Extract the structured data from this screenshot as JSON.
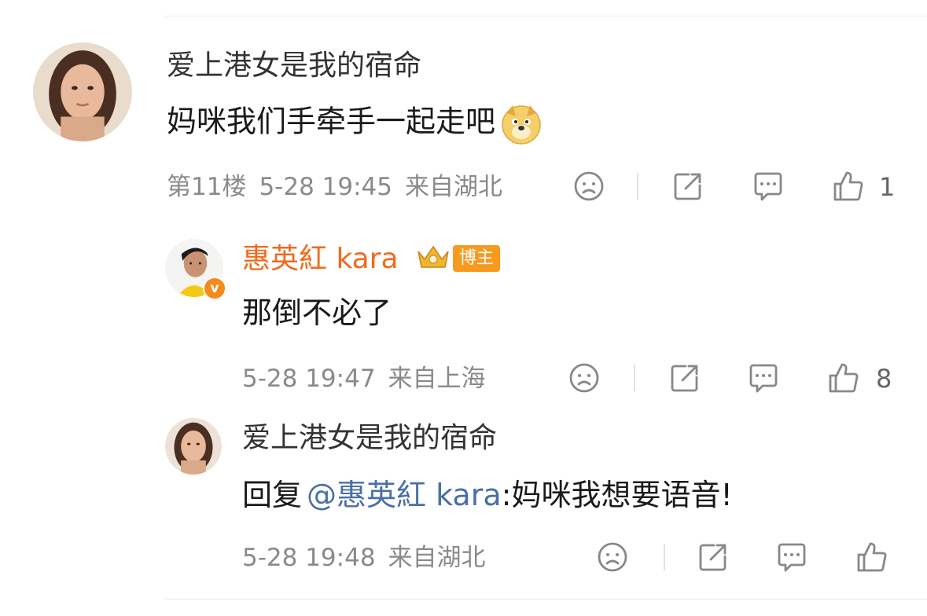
{
  "comments": [
    {
      "author": "爱上港女是我的宿命",
      "text": "妈咪我们手牵手一起走吧",
      "emoji": "doge-emoji",
      "floor": "第11楼",
      "time": "5-28 19:45",
      "location": "来自湖北",
      "likes": "1"
    },
    {
      "author": "惠英紅 kara",
      "badge": "博主",
      "verified": "v",
      "text": "那倒不必了",
      "time": "5-28 19:47",
      "location": "来自上海",
      "likes": "8"
    },
    {
      "author": "爱上港女是我的宿命",
      "reply_prefix": "回复",
      "reply_mention": "@惠英紅 kara",
      "text": ":妈咪我想要语音!",
      "time": "5-28 19:48",
      "location": "来自湖北"
    }
  ],
  "icons": {
    "dislike": "frown-face-icon",
    "share": "share-icon",
    "comment": "comment-bubble-icon",
    "like": "thumbs-up-icon"
  },
  "colors": {
    "blogger_name": "#f06a1c",
    "mention": "#4a6fa8",
    "meta": "#8a8a8a",
    "badge": "#f79a1f"
  }
}
